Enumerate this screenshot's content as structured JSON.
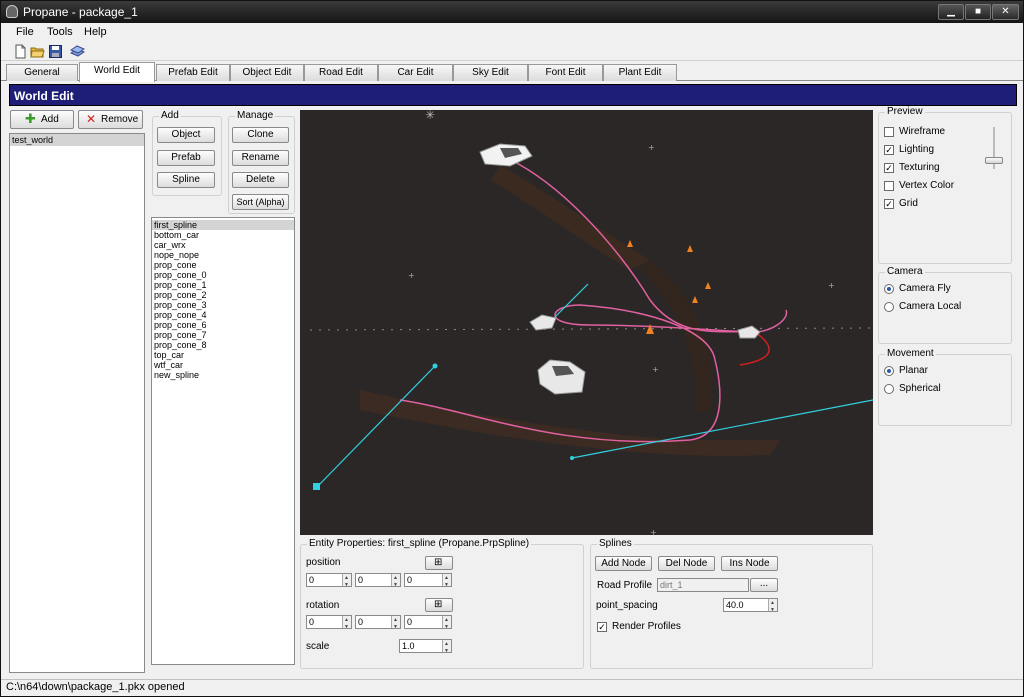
{
  "window": {
    "title": "Propane - package_1"
  },
  "menu": {
    "file": "File",
    "tools": "Tools",
    "help": "Help"
  },
  "toolbar": {
    "icons": [
      "new-file-icon",
      "open-folder-icon",
      "save-icon",
      "package-icon"
    ]
  },
  "tabs": [
    {
      "label": "General"
    },
    {
      "label": "World Edit"
    },
    {
      "label": "Prefab Edit"
    },
    {
      "label": "Object Edit"
    },
    {
      "label": "Road Edit"
    },
    {
      "label": "Car Edit"
    },
    {
      "label": "Sky Edit"
    },
    {
      "label": "Font Edit"
    },
    {
      "label": "Plant Edit"
    }
  ],
  "header": {
    "title": "World Edit"
  },
  "worlds": {
    "add_label": "Add",
    "remove_label": "Remove",
    "items": [
      "test_world"
    ]
  },
  "add_group": {
    "label": "Add",
    "object": "Object",
    "prefab": "Prefab",
    "spline": "Spline"
  },
  "manage_group": {
    "label": "Manage",
    "clone": "Clone",
    "rename": "Rename",
    "delete": "Delete",
    "sort": "Sort (Alpha)"
  },
  "entities": {
    "items": [
      "first_spline",
      "bottom_car",
      "car_wrx",
      "nope_nope",
      "prop_cone",
      "prop_cone_0",
      "prop_cone_1",
      "prop_cone_2",
      "prop_cone_3",
      "prop_cone_4",
      "prop_cone_6",
      "prop_cone_7",
      "prop_cone_8",
      "top_car",
      "wtf_car",
      "new_spline"
    ]
  },
  "entity_props": {
    "title": "Entity Properties: first_spline (Propane.PrpSpline)",
    "position_label": "position",
    "position": [
      "0",
      "0",
      "0"
    ],
    "rotation_label": "rotation",
    "rotation": [
      "0",
      "0",
      "0"
    ],
    "scale_label": "scale",
    "scale": "1.0"
  },
  "splines": {
    "label": "Splines",
    "add_node": "Add Node",
    "del_node": "Del Node",
    "ins_node": "Ins Node",
    "road_profile_label": "Road Profile",
    "road_profile": "dirt_1",
    "browse": "...",
    "point_spacing_label": "point_spacing",
    "point_spacing": "40.0",
    "render_profiles_label": "Render Profiles",
    "render_profiles": true
  },
  "preview": {
    "label": "Preview",
    "wireframe": "Wireframe",
    "lighting": "Lighting",
    "texturing": "Texturing",
    "vertex_color": "Vertex Color",
    "grid": "Grid",
    "checked": {
      "wireframe": false,
      "lighting": true,
      "texturing": true,
      "vertex_color": false,
      "grid": true
    }
  },
  "camera": {
    "label": "Camera",
    "fly": "Camera Fly",
    "local": "Camera Local",
    "selected": "fly"
  },
  "movement": {
    "label": "Movement",
    "planar": "Planar",
    "spherical": "Spherical",
    "selected": "planar"
  },
  "status": {
    "text": "C:\\n64\\down\\package_1.pkx opened"
  },
  "colors": {
    "header_band": "#1e1e78",
    "viewport_bg": "#2b2726",
    "spline_pink": "#e060a0",
    "spline_cyan": "#30d0e0"
  }
}
